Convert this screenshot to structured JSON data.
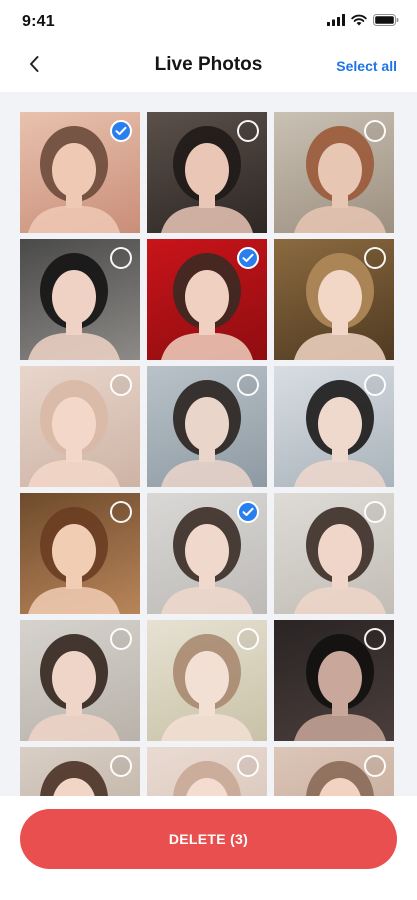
{
  "status_bar": {
    "time": "9:41",
    "icons": [
      "cellular-signal-icon",
      "wifi-icon",
      "battery-icon"
    ]
  },
  "header": {
    "back_icon": "chevron-left-icon",
    "title": "Live Photos",
    "select_all": "Select all"
  },
  "colors": {
    "accent": "#1f74e8",
    "check_selected": "#2a7ff0",
    "delete": "#ea4f4f",
    "grid_bg": "#f1f3f6"
  },
  "photos": [
    {
      "selected": true,
      "bg1": "#e8c2ae",
      "bg2": "#c98e79",
      "skin": "#f0c9b5",
      "hair": "#6b4a3a"
    },
    {
      "selected": false,
      "bg1": "#5b504a",
      "bg2": "#2e2724",
      "skin": "#e9c6b6",
      "hair": "#1f1a18"
    },
    {
      "selected": false,
      "bg1": "#c9c1b4",
      "bg2": "#9c8f80",
      "skin": "#e7c6b4",
      "hair": "#9b5a3a"
    },
    {
      "selected": false,
      "bg1": "#4a4a49",
      "bg2": "#8d8a87",
      "skin": "#efd2c4",
      "hair": "#151414"
    },
    {
      "selected": true,
      "bg1": "#c8141a",
      "bg2": "#8f0d10",
      "skin": "#f0d0c0",
      "hair": "#3a2a22"
    },
    {
      "selected": false,
      "bg1": "#8b6a3f",
      "bg2": "#4f3a22",
      "skin": "#f2d6c6",
      "hair": "#b08a5a"
    },
    {
      "selected": false,
      "bg1": "#e8d6cc",
      "bg2": "#cdb3a4",
      "skin": "#f3d8c9",
      "hair": "#d9b9a6"
    },
    {
      "selected": false,
      "bg1": "#b9c2c8",
      "bg2": "#8e9aa3",
      "skin": "#ead5ca",
      "hair": "#2a2220"
    },
    {
      "selected": false,
      "bg1": "#d8dde2",
      "bg2": "#aab3bb",
      "skin": "#efd8cc",
      "hair": "#1c1a1a"
    },
    {
      "selected": false,
      "bg1": "#6e4b2c",
      "bg2": "#b9855a",
      "skin": "#f1cdb4",
      "hair": "#6a3d22"
    },
    {
      "selected": true,
      "bg1": "#d9d8d6",
      "bg2": "#bdbab6",
      "skin": "#f0d8cc",
      "hair": "#3a2c26"
    },
    {
      "selected": false,
      "bg1": "#dedbd6",
      "bg2": "#c2bdb6",
      "skin": "#efd6c9",
      "hair": "#3c2d27"
    },
    {
      "selected": false,
      "bg1": "#d6d2cd",
      "bg2": "#b8b2aa",
      "skin": "#efd5c7",
      "hair": "#33261f"
    },
    {
      "selected": false,
      "bg1": "#e6e1d2",
      "bg2": "#c9c2a7",
      "skin": "#f3e0d4",
      "hair": "#a88a70"
    },
    {
      "selected": false,
      "bg1": "#2a2424",
      "bg2": "#4a3e3c",
      "skin": "#c9a79a",
      "hair": "#120f0f"
    },
    {
      "selected": false,
      "bg1": "#d9cfc6",
      "bg2": "#b9a99b",
      "skin": "#f1d5c5",
      "hair": "#4a3226"
    },
    {
      "selected": false,
      "bg1": "#eadbd2",
      "bg2": "#d2beb2",
      "skin": "#f4dcd0",
      "hair": "#c9a996"
    },
    {
      "selected": false,
      "bg1": "#dcc6b8",
      "bg2": "#bfa493",
      "skin": "#f2d3c2",
      "hair": "#8a6a58"
    }
  ],
  "delete_button": {
    "label": "DELETE (3)"
  }
}
